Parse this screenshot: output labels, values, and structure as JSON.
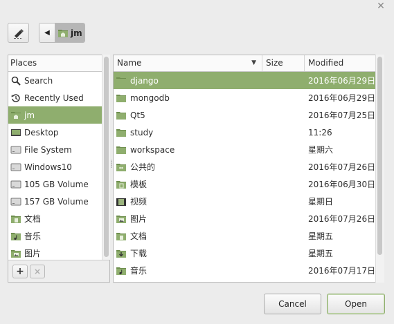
{
  "window": {
    "close_icon": "close-icon"
  },
  "location": {
    "edit_icon": "pencil-icon",
    "back_icon": "left-arrow-icon",
    "crumb": "jm"
  },
  "places": {
    "header": "Places",
    "items": [
      {
        "label": "Search",
        "icon": "search-icon"
      },
      {
        "label": "Recently Used",
        "icon": "recent-icon"
      },
      {
        "label": "jm",
        "icon": "home-folder-icon",
        "selected": true
      },
      {
        "label": "Desktop",
        "icon": "desktop-icon"
      },
      {
        "label": "File System",
        "icon": "drive-icon"
      },
      {
        "label": "Windows10",
        "icon": "drive-icon"
      },
      {
        "label": "105 GB Volume",
        "icon": "drive-icon"
      },
      {
        "label": "157 GB Volume",
        "icon": "drive-icon"
      },
      {
        "label": "文档",
        "icon": "documents-folder-icon"
      },
      {
        "label": "音乐",
        "icon": "music-folder-icon"
      },
      {
        "label": "图片",
        "icon": "pictures-folder-icon"
      }
    ],
    "add_label": "+",
    "remove_label": "×"
  },
  "files": {
    "columns": {
      "name": "Name",
      "size": "Size",
      "modified": "Modified"
    },
    "rows": [
      {
        "name": "django",
        "size": "",
        "modified": "2016年06月29日",
        "icon": "folder-icon",
        "selected": true
      },
      {
        "name": "mongodb",
        "size": "",
        "modified": "2016年06月29日",
        "icon": "folder-icon"
      },
      {
        "name": "Qt5",
        "size": "",
        "modified": "2016年07月25日",
        "icon": "folder-icon"
      },
      {
        "name": "study",
        "size": "",
        "modified": "11:26",
        "icon": "folder-icon"
      },
      {
        "name": "workspace",
        "size": "",
        "modified": "星期六",
        "icon": "folder-icon"
      },
      {
        "name": "公共的",
        "size": "",
        "modified": "2016年07月26日",
        "icon": "public-folder-icon"
      },
      {
        "name": "模板",
        "size": "",
        "modified": "2016年06月30日",
        "icon": "templates-folder-icon"
      },
      {
        "name": "视频",
        "size": "",
        "modified": "星期日",
        "icon": "videos-folder-icon"
      },
      {
        "name": "图片",
        "size": "",
        "modified": "2016年07月26日",
        "icon": "pictures-folder-icon"
      },
      {
        "name": "文档",
        "size": "",
        "modified": "星期五",
        "icon": "documents-folder-icon"
      },
      {
        "name": "下载",
        "size": "",
        "modified": "星期五",
        "icon": "downloads-folder-icon"
      },
      {
        "name": "音乐",
        "size": "",
        "modified": "2016年07月17日",
        "icon": "music-folder-icon"
      }
    ]
  },
  "buttons": {
    "cancel": "Cancel",
    "open": "Open"
  },
  "colors": {
    "selection": "#8fae6e",
    "folder": "#8fae6e"
  }
}
